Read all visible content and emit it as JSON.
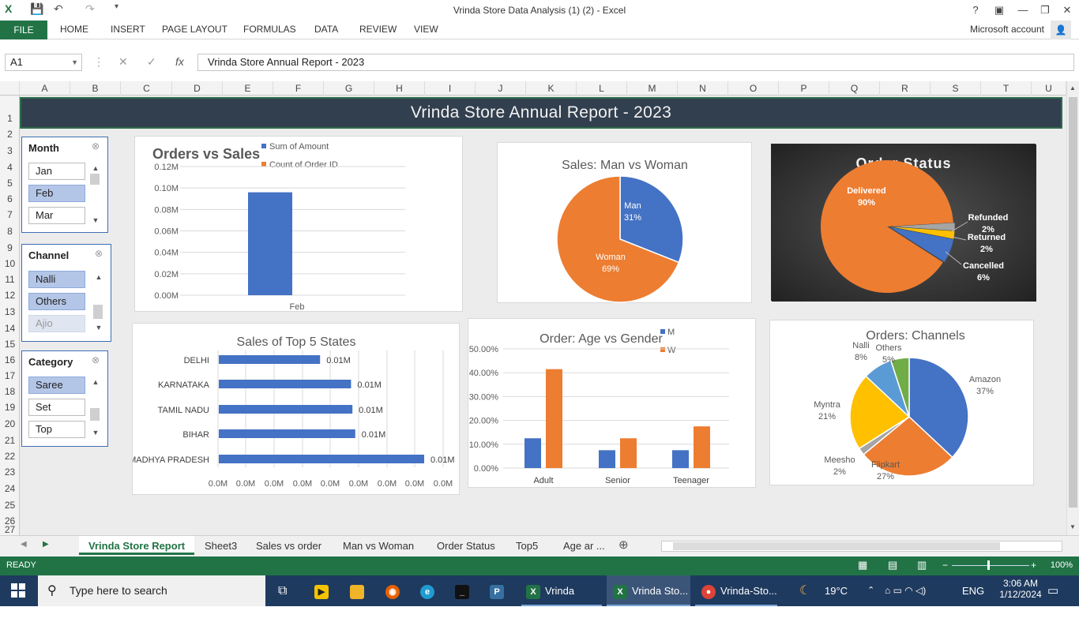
{
  "window": {
    "title": "Vrinda Store Data Analysis (1) (2) - Excel",
    "help": "?",
    "minimize": "—",
    "restore": "❐",
    "close": "✕"
  },
  "ribbon": {
    "file": "FILE",
    "tabs": [
      "HOME",
      "INSERT",
      "PAGE LAYOUT",
      "FORMULAS",
      "DATA",
      "REVIEW",
      "VIEW"
    ],
    "account": "Microsoft account"
  },
  "formula_bar": {
    "name_box": "A1",
    "cancel": "✕",
    "enter": "✓",
    "fx": "fx",
    "value": "Vrinda Store Annual Report -  2023"
  },
  "columns": [
    "A",
    "B",
    "C",
    "D",
    "E",
    "F",
    "G",
    "H",
    "I",
    "J",
    "K",
    "L",
    "M",
    "N",
    "O",
    "P",
    "Q",
    "R",
    "S",
    "T",
    "U"
  ],
  "rows": [
    "1",
    "2",
    "3",
    "4",
    "5",
    "6",
    "7",
    "8",
    "9",
    "10",
    "11",
    "12",
    "13",
    "14",
    "15",
    "16",
    "17",
    "18",
    "19",
    "20",
    "21",
    "22",
    "23",
    "24",
    "25",
    "26",
    "27"
  ],
  "banner": "Vrinda Store Annual Report -  2023",
  "slicers": {
    "month": {
      "title": "Month",
      "items": [
        "Jan",
        "Feb",
        "Mar"
      ],
      "selected": "Feb"
    },
    "channel": {
      "title": "Channel",
      "items": [
        "Nalli",
        "Others",
        "Ajio"
      ],
      "selected": [
        "Nalli",
        "Others"
      ]
    },
    "category": {
      "title": "Category",
      "items": [
        "Saree",
        "Set",
        "Top"
      ],
      "selected": "Saree"
    }
  },
  "charts": {
    "orders_sales": {
      "title": "Orders vs Sales",
      "legend": [
        "Sum of Amount",
        "Count of Order ID"
      ],
      "y_ticks": [
        "0.12M",
        "0.10M",
        "0.08M",
        "0.06M",
        "0.04M",
        "0.02M",
        "0.00M"
      ],
      "category": "Feb"
    },
    "man_woman": {
      "title": "Sales: Man vs Woman",
      "man_label": "Man",
      "man_pct": "31%",
      "woman_label": "Woman",
      "woman_pct": "69%"
    },
    "order_status": {
      "title": "Order Status",
      "labels": [
        "Delivered",
        "Refunded",
        "Returned",
        "Cancelled"
      ],
      "pcts": [
        "90%",
        "2%",
        "2%",
        "6%"
      ]
    },
    "top5": {
      "title": "Sales of Top 5 States",
      "states": [
        "DELHI",
        "KARNATAKA",
        "TAMIL NADU",
        "BIHAR",
        "MADHYA PRADESH"
      ],
      "labels": [
        "0.01M",
        "0.01M",
        "0.01M",
        "0.01M",
        "0.01M"
      ],
      "x_ticks": [
        "0.0M",
        "0.0M",
        "0.0M",
        "0.0M",
        "0.0M",
        "0.0M",
        "0.0M",
        "0.0M",
        "0.0M"
      ]
    },
    "age_gender": {
      "title": "Order: Age vs Gender",
      "legend": [
        "M",
        "W"
      ],
      "y_ticks": [
        "50.00%",
        "40.00%",
        "30.00%",
        "20.00%",
        "10.00%",
        "0.00%"
      ],
      "categories": [
        "Adult",
        "Senior",
        "Teenager"
      ]
    },
    "channels": {
      "title": "Orders: Channels",
      "labels": [
        "Amazon",
        "Flipkart",
        "Meesho",
        "Myntra",
        "Nalli",
        "Others"
      ],
      "pcts": [
        "37%",
        "27%",
        "2%",
        "21%",
        "8%",
        "5%"
      ]
    }
  },
  "chart_data": [
    {
      "type": "bar",
      "title": "Orders vs Sales",
      "categories": [
        "Feb"
      ],
      "series": [
        {
          "name": "Sum of Amount",
          "values": [
            0.096
          ]
        },
        {
          "name": "Count of Order ID",
          "values": [
            0
          ]
        }
      ],
      "ylim": [
        0,
        0.12
      ],
      "colors": [
        "#4472c4",
        "#ed7d31"
      ]
    },
    {
      "type": "pie",
      "title": "Sales: Man vs Woman",
      "categories": [
        "Man",
        "Woman"
      ],
      "values": [
        31,
        69
      ],
      "colors": [
        "#4472c4",
        "#ed7d31"
      ]
    },
    {
      "type": "pie",
      "title": "Order Status",
      "categories": [
        "Delivered",
        "Refunded",
        "Returned",
        "Cancelled"
      ],
      "values": [
        90,
        2,
        2,
        6
      ],
      "colors": [
        "#ed7d31",
        "#a5a5a5",
        "#ffc000",
        "#4472c4"
      ]
    },
    {
      "type": "bar",
      "title": "Sales of Top 5 States",
      "categories": [
        "DELHI",
        "KARNATAKA",
        "TAMIL NADU",
        "BIHAR",
        "MADHYA PRADESH"
      ],
      "values": [
        0.0072,
        0.0094,
        0.0095,
        0.0097,
        0.0146
      ],
      "orientation": "horizontal",
      "color": "#4472c4"
    },
    {
      "type": "bar",
      "title": "Order: Age vs Gender",
      "categories": [
        "Adult",
        "Senior",
        "Teenager"
      ],
      "series": [
        {
          "name": "M",
          "values": [
            12.5,
            7.5,
            7.5
          ]
        },
        {
          "name": "W",
          "values": [
            41.5,
            12.5,
            17.5
          ]
        }
      ],
      "ylim": [
        0,
        50
      ],
      "colors": [
        "#4472c4",
        "#ed7d31"
      ]
    },
    {
      "type": "pie",
      "title": "Orders: Channels",
      "categories": [
        "Amazon",
        "Flipkart",
        "Meesho",
        "Myntra",
        "Nalli",
        "Others"
      ],
      "values": [
        37,
        27,
        2,
        21,
        8,
        5
      ],
      "colors": [
        "#4472c4",
        "#ed7d31",
        "#a5a5a5",
        "#ffc000",
        "#5b9bd5",
        "#70ad47"
      ]
    }
  ],
  "sheet_tabs": [
    "Vrinda Store Report",
    "Sheet3",
    "Sales vs order",
    "Man vs Woman",
    "Order Status",
    "Top5",
    "Age ar ..."
  ],
  "status": {
    "ready": "READY",
    "zoom": "100%"
  },
  "taskbar": {
    "search": "Type here to search",
    "apps": [
      "Vrinda Stor...",
      "Vrinda Sto...",
      "Vrinda-Sto..."
    ],
    "weather": "19°C",
    "lang": "ENG",
    "time": "3:06 AM",
    "date": "1/12/2024"
  }
}
